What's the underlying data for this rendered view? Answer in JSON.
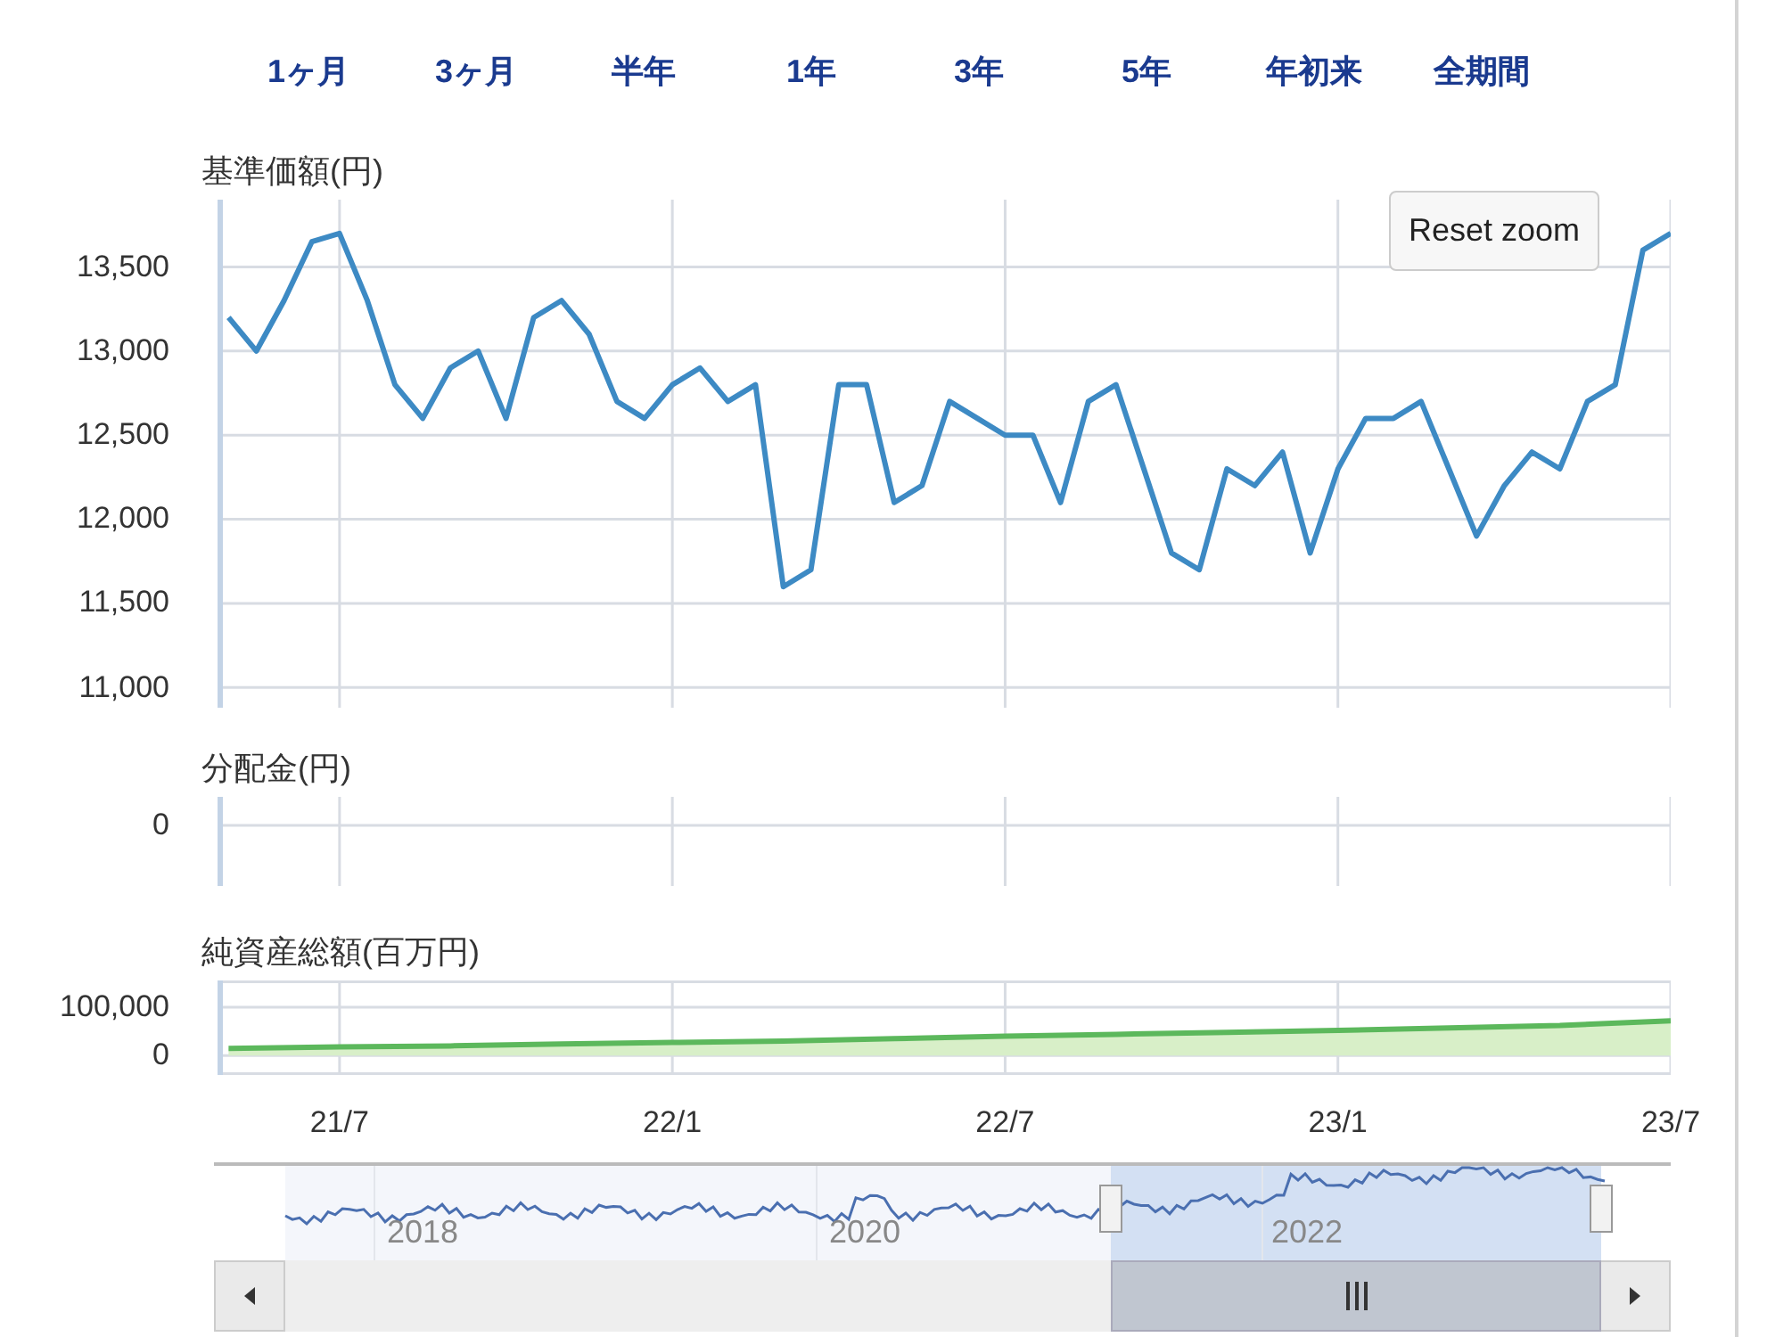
{
  "range_tabs": [
    {
      "label": "1ヶ月"
    },
    {
      "label": "3ヶ月"
    },
    {
      "label": "半年"
    },
    {
      "label": "1年"
    },
    {
      "label": "3年"
    },
    {
      "label": "5年"
    },
    {
      "label": "年初来"
    },
    {
      "label": "全期間"
    }
  ],
  "price": {
    "title": "基準価額(円)",
    "reset_button": "Reset zoom",
    "chart_data": {
      "type": "line",
      "grid": true,
      "ylim": [
        10880,
        13900
      ],
      "categories": [
        null,
        null,
        null,
        null,
        null,
        null,
        null,
        null,
        null,
        null,
        null,
        null,
        null,
        null,
        null,
        null,
        null,
        null,
        null,
        null,
        null,
        null,
        null,
        null,
        null,
        null,
        null,
        null,
        null,
        null,
        null,
        null,
        null,
        null,
        null,
        null,
        null,
        null,
        null,
        null,
        null,
        null,
        null,
        null,
        null,
        null,
        null,
        null,
        null,
        null,
        null,
        null,
        null
      ],
      "series": [
        {
          "color": "#3d8ac4",
          "values": [
            13200,
            13000,
            13300,
            13650,
            13700,
            13300,
            12800,
            12600,
            12900,
            13000,
            12600,
            13200,
            13300,
            13100,
            12700,
            12600,
            12800,
            12900,
            12700,
            12800,
            11600,
            11700,
            12800,
            12800,
            12100,
            12200,
            12700,
            12600,
            12500,
            12500,
            12100,
            12700,
            12800,
            12300,
            11800,
            11700,
            12300,
            12200,
            12400,
            11800,
            12300,
            12600,
            12600,
            12700,
            12300,
            11900,
            12200,
            12400,
            12300,
            12700,
            12800,
            13600,
            13700
          ]
        }
      ],
      "yticks": [
        {
          "value": 11000,
          "label": "11,000"
        },
        {
          "value": 11500,
          "label": "11,500"
        },
        {
          "value": 12000,
          "label": "12,000"
        },
        {
          "value": 12500,
          "label": "12,500"
        },
        {
          "value": 13000,
          "label": "13,000"
        },
        {
          "value": 13500,
          "label": "13,500"
        }
      ]
    }
  },
  "distribution": {
    "title": "分配金(円)",
    "ytick_labels": [
      "0"
    ]
  },
  "net_assets": {
    "title": "純資産総額(百万円)",
    "chart_data": {
      "type": "area",
      "grid": true,
      "ylim": [
        -40000,
        155000
      ],
      "categories": [
        null,
        "21/7",
        null,
        null,
        "22/1",
        null,
        null,
        "22/7",
        null,
        null,
        "23/1",
        null,
        null,
        "23/7"
      ],
      "series": [
        {
          "color": "#5cb85c",
          "values": [
            15000,
            18000,
            20000,
            24000,
            27000,
            30000,
            35000,
            40000,
            44000,
            48000,
            52000,
            57000,
            62000,
            72000
          ]
        }
      ],
      "yticks": [
        {
          "value": 0,
          "label": "0"
        },
        {
          "value": 100000,
          "label": "100,000"
        }
      ]
    }
  },
  "navigator": {
    "year_labels": [
      "2018",
      "2020",
      "2022"
    ]
  }
}
